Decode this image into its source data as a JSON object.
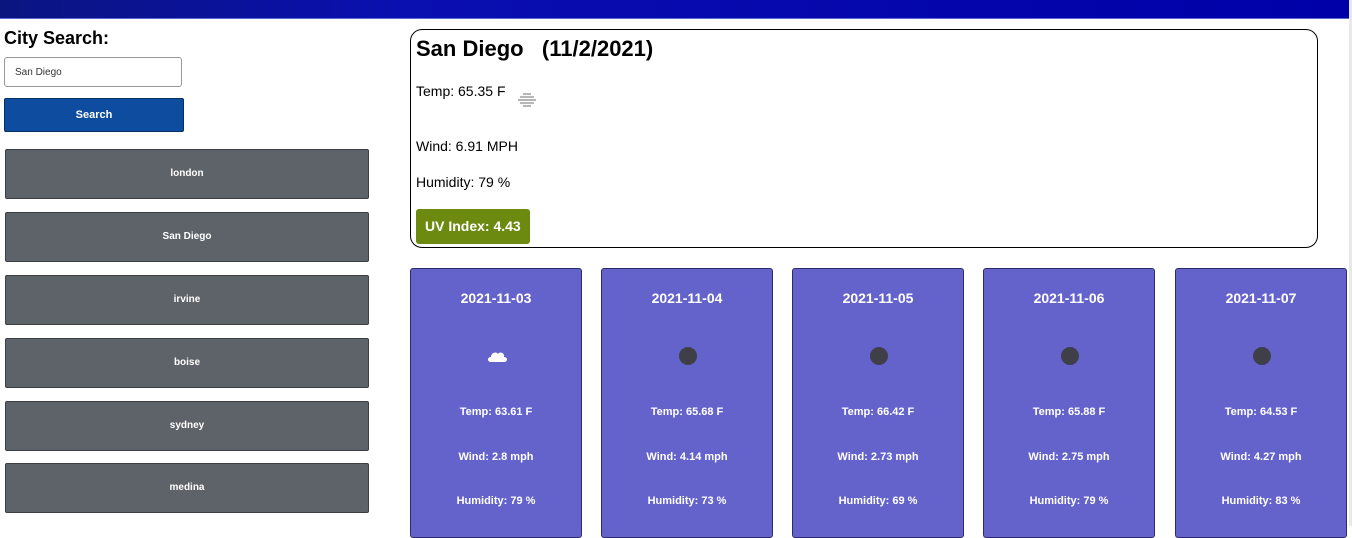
{
  "sidebar": {
    "search_label": "City Search:",
    "search_value": "San Diego",
    "search_button": "Search",
    "history": [
      {
        "label": "london"
      },
      {
        "label": "San Diego"
      },
      {
        "label": "irvine"
      },
      {
        "label": "boise"
      },
      {
        "label": "sydney"
      },
      {
        "label": "medina"
      }
    ]
  },
  "current": {
    "title": "San Diego   (11/2/2021)",
    "temp": "Temp: 65.35 F",
    "icon": "mist-icon",
    "wind": "Wind: 6.91 MPH",
    "humidity": "Humidity: 79 %",
    "uv": "UV Index: 4.43",
    "uv_color": "#6b8a0f"
  },
  "forecast": [
    {
      "date": "2021-11-03",
      "icon": "cloud-icon",
      "temp": "Temp: 63.61 F",
      "wind": "Wind: 2.8 mph",
      "humidity": "Humidity: 79 %"
    },
    {
      "date": "2021-11-04",
      "icon": "dark-circle-icon",
      "temp": "Temp: 65.68 F",
      "wind": "Wind: 4.14 mph",
      "humidity": "Humidity: 73 %"
    },
    {
      "date": "2021-11-05",
      "icon": "dark-circle-icon",
      "temp": "Temp: 66.42 F",
      "wind": "Wind: 2.73 mph",
      "humidity": "Humidity: 69 %"
    },
    {
      "date": "2021-11-06",
      "icon": "dark-circle-icon",
      "temp": "Temp: 65.88 F",
      "wind": "Wind: 2.75 mph",
      "humidity": "Humidity: 79 %"
    },
    {
      "date": "2021-11-07",
      "icon": "dark-circle-icon",
      "temp": "Temp: 64.53 F",
      "wind": "Wind: 4.27 mph",
      "humidity": "Humidity: 83 %"
    }
  ],
  "colors": {
    "header": "#0a0fb0",
    "search_button": "#0d4c9e",
    "history_button": "#5e6369",
    "forecast_card": "#6463cc"
  }
}
